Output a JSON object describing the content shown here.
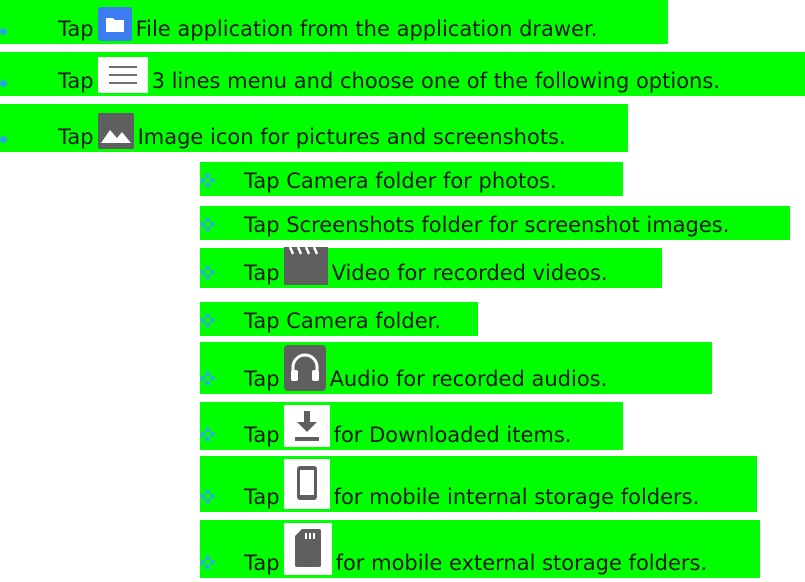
{
  "steps": [
    {
      "tap": "Tap",
      "icon": "folder-icon",
      "text": "File application from the application drawer."
    },
    {
      "tap": "Tap",
      "icon": "menu-icon",
      "text": "3 lines menu and choose one of the following options."
    },
    {
      "tap": "Tap",
      "icon": "image-icon",
      "text": "Image icon for pictures and screenshots."
    }
  ],
  "substeps": [
    {
      "text": "Tap Camera folder for photos."
    },
    {
      "text": "Tap Screenshots folder for screenshot images."
    },
    {
      "tap": "Tap",
      "icon": "video-icon",
      "text": "Video for recorded videos."
    },
    {
      "text": "Tap Camera folder."
    },
    {
      "tap": "Tap",
      "icon": "headphones-icon",
      "text": "Audio for recorded audios."
    },
    {
      "tap": "Tap",
      "icon": "download-icon",
      "text": "for Downloaded items."
    },
    {
      "tap": "Tap",
      "icon": "phone-icon",
      "text": "for mobile internal storage folders."
    },
    {
      "tap": "Tap",
      "icon": "sd-card-icon",
      "text": "for mobile external storage folders."
    }
  ],
  "colors": {
    "highlight": "#00ff00",
    "bullet": "#22a6e6",
    "icon_blue": "#3b7cf0",
    "icon_gray": "#606060"
  }
}
